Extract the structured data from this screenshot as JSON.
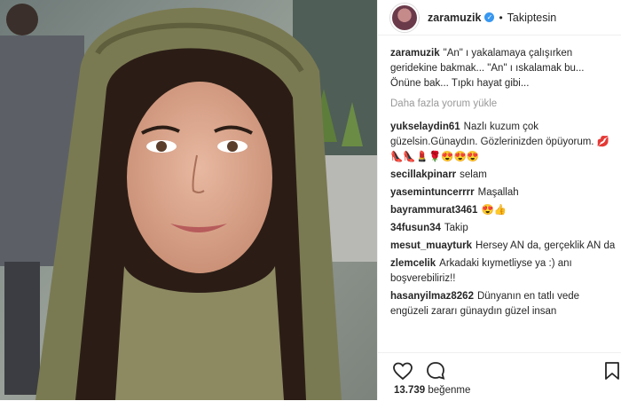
{
  "post": {
    "username": "zaramuzik",
    "follow_status": "Takiptesin",
    "caption": "\"An\" ı yakalamaya çalışırken geridekine bakmak... \"An\" ı ıskalamak bu... Önüne bak... Tıpkı hayat gibi...",
    "load_more": "Daha fazla yorum yükle",
    "likes_count": "13.739",
    "likes_label": "beğenme"
  },
  "comments": [
    {
      "user": "yukselaydin61",
      "text": "Nazlı kuzum çok güzelsin.Günaydın. Gözlerinizden öpüyorum. 💋👠👠💄🌹😍😍😍"
    },
    {
      "user": "secillakpinarr",
      "text": "selam"
    },
    {
      "user": "yasemintuncerrrr",
      "text": "Maşallah"
    },
    {
      "user": "bayrammurat3461",
      "text": "😍👍"
    },
    {
      "user": "34fusun34",
      "text": "Takip"
    },
    {
      "user": "mesut_muayturk",
      "text": "Hersey AN da, gerçeklik AN da"
    },
    {
      "user": "zlemcelik",
      "text": "Arkadaki kıymetliyse ya :) anı boşverebiliriz!!"
    },
    {
      "user": "hasanyilmaz8262",
      "text": "Dünyanın en tatlı vede engüzeli zararı günaydın güzel insan"
    }
  ],
  "icons": {
    "like": "heart-icon",
    "comment": "comment-icon",
    "save": "bookmark-icon",
    "verified": "verified-badge-icon"
  },
  "colors": {
    "verified_blue": "#3897f0",
    "muted_text": "#999999"
  }
}
